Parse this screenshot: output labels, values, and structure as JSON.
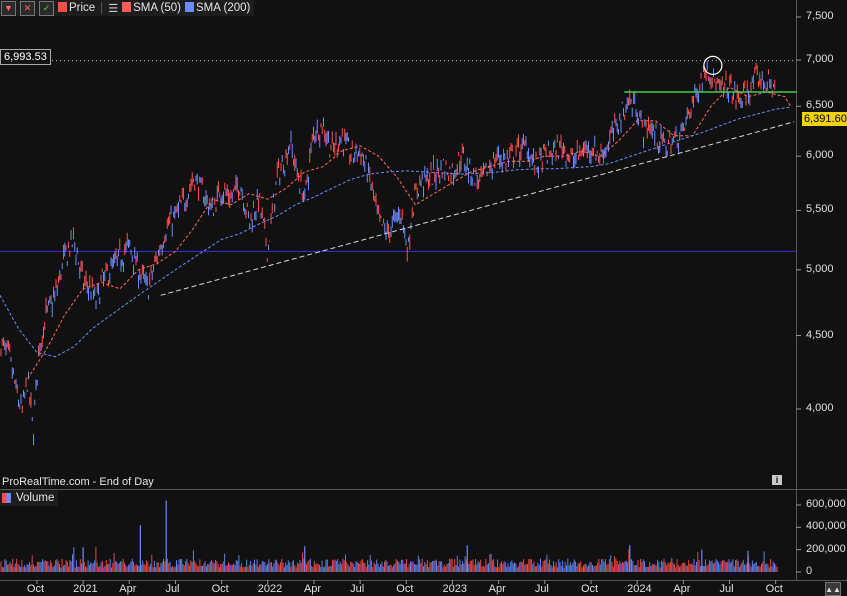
{
  "legend": {
    "price_label": "Price",
    "sma50_label": "SMA (50)",
    "sma200_label": "SMA (200)",
    "price_color": "#ff4d4d",
    "sma50_color": "#ff5a5a",
    "sma200_color": "#6a8cff"
  },
  "volume_legend": {
    "label": "Volume"
  },
  "source": "ProRealTime.com - End of Day",
  "reference_value": "6,993.53",
  "last_price": "6,391.60",
  "colors": {
    "background": "#111111",
    "up_bar": "#6a8cff",
    "down_bar": "#ff4d4d",
    "resistance": "#39d353",
    "support": "#3030c0",
    "trend": "#d8d8d8",
    "last_price_bg": "#f2d20f"
  },
  "chart_data": [
    {
      "type": "line",
      "title": "",
      "log_scale": true,
      "y_ticks": [
        "7,500",
        "7,000",
        "6,500",
        "6,000",
        "5,500",
        "5,000",
        "4,500",
        "4,000"
      ],
      "y_tick_values": [
        7500,
        7000,
        6500,
        6000,
        5500,
        5000,
        4500,
        4000
      ],
      "ylim": [
        3750,
        7800
      ],
      "x_ticks": [
        "Oct",
        "2021",
        "Apr",
        "Jul",
        "Oct",
        "2022",
        "Apr",
        "Jul",
        "Oct",
        "2023",
        "Apr",
        "Jul",
        "Oct",
        "2024",
        "Apr",
        "Jul",
        "Oct"
      ],
      "x_tick_times": [
        2020.75,
        2021.0,
        2021.25,
        2021.5,
        2021.75,
        2022.0,
        2022.25,
        2022.5,
        2022.75,
        2023.0,
        2023.25,
        2023.5,
        2023.75,
        2024.0,
        2024.25,
        2024.5,
        2024.75
      ],
      "xlim": [
        2020.55,
        2024.86
      ],
      "series": [
        {
          "name": "Price",
          "x": [
            2020.55,
            2020.6,
            2020.64,
            2020.67,
            2020.7,
            2020.73,
            2020.76,
            2020.8,
            2020.85,
            2020.9,
            2020.95,
            2021.0,
            2021.04,
            2021.07,
            2021.1,
            2021.15,
            2021.2,
            2021.25,
            2021.3,
            2021.35,
            2021.4,
            2021.45,
            2021.5,
            2021.55,
            2021.6,
            2021.65,
            2021.7,
            2021.75,
            2021.8,
            2021.85,
            2021.9,
            2021.95,
            2022.0,
            2022.05,
            2022.1,
            2022.12,
            2022.15,
            2022.2,
            2022.25,
            2022.3,
            2022.35,
            2022.4,
            2022.45,
            2022.5,
            2022.55,
            2022.6,
            2022.65,
            2022.72,
            2022.76,
            2022.78,
            2022.82,
            2022.88,
            2022.95,
            2023.0,
            2023.05,
            2023.1,
            2023.15,
            2023.2,
            2023.25,
            2023.3,
            2023.35,
            2023.4,
            2023.45,
            2023.5,
            2023.55,
            2023.6,
            2023.65,
            2023.7,
            2023.75,
            2023.8,
            2023.85,
            2023.9,
            2023.95,
            2024.0,
            2024.03,
            2024.07,
            2024.1,
            2024.15,
            2024.2,
            2024.25,
            2024.3,
            2024.35,
            2024.38,
            2024.41,
            2024.45,
            2024.5,
            2024.55,
            2024.6,
            2024.65,
            2024.7,
            2024.75,
            2024.8,
            2024.83
          ],
          "values": [
            4450,
            4350,
            4100,
            3980,
            4200,
            3850,
            4400,
            4650,
            4800,
            5100,
            5250,
            4900,
            4850,
            4750,
            4900,
            5000,
            5100,
            5200,
            5000,
            4850,
            5100,
            5350,
            5450,
            5600,
            5800,
            5650,
            5500,
            5700,
            5600,
            5750,
            5400,
            5600,
            5150,
            5800,
            6000,
            6150,
            5900,
            5600,
            6250,
            6300,
            6050,
            6200,
            6000,
            6050,
            5800,
            5400,
            5300,
            5500,
            5150,
            5500,
            5750,
            5800,
            5900,
            5850,
            6000,
            5850,
            5750,
            5900,
            6000,
            5950,
            6050,
            6100,
            5900,
            6000,
            6050,
            6100,
            5950,
            6050,
            6100,
            6000,
            6150,
            6350,
            6550,
            6500,
            6250,
            6300,
            6200,
            6100,
            6150,
            6250,
            6550,
            6800,
            6950,
            6800,
            6650,
            6700,
            6550,
            6650,
            6800,
            6750,
            6700,
            6550,
            6390
          ]
        },
        {
          "name": "SMA (50)",
          "x": [
            2020.7,
            2020.8,
            2020.9,
            2021.0,
            2021.1,
            2021.2,
            2021.3,
            2021.4,
            2021.5,
            2021.6,
            2021.7,
            2021.8,
            2021.9,
            2022.0,
            2022.1,
            2022.2,
            2022.3,
            2022.4,
            2022.5,
            2022.6,
            2022.7,
            2022.8,
            2022.9,
            2023.0,
            2023.1,
            2023.2,
            2023.3,
            2023.4,
            2023.5,
            2023.6,
            2023.7,
            2023.8,
            2023.9,
            2024.0,
            2024.1,
            2024.2,
            2024.3,
            2024.4,
            2024.5,
            2024.6,
            2024.7,
            2024.8,
            2024.83
          ],
          "values": [
            4200,
            4400,
            4650,
            4850,
            4900,
            4850,
            5000,
            5050,
            5150,
            5350,
            5600,
            5550,
            5650,
            5600,
            5700,
            5850,
            5900,
            6050,
            6100,
            6000,
            5800,
            5550,
            5650,
            5750,
            5850,
            5900,
            5950,
            5950,
            6000,
            6000,
            6050,
            6000,
            6150,
            6350,
            6350,
            6200,
            6200,
            6500,
            6700,
            6600,
            6650,
            6600,
            6500
          ]
        },
        {
          "name": "SMA (200)",
          "x": [
            2020.55,
            2020.65,
            2020.75,
            2020.85,
            2020.95,
            2021.05,
            2021.15,
            2021.25,
            2021.35,
            2021.45,
            2021.55,
            2021.65,
            2021.75,
            2021.85,
            2021.95,
            2022.05,
            2022.15,
            2022.25,
            2022.35,
            2022.45,
            2022.55,
            2022.65,
            2022.75,
            2022.85,
            2022.95,
            2023.05,
            2023.15,
            2023.25,
            2023.35,
            2023.45,
            2023.55,
            2023.65,
            2023.75,
            2023.85,
            2023.95,
            2024.05,
            2024.15,
            2024.25,
            2024.35,
            2024.45,
            2024.55,
            2024.65,
            2024.75,
            2024.83
          ],
          "values": [
            4800,
            4550,
            4380,
            4350,
            4420,
            4550,
            4650,
            4750,
            4850,
            4950,
            5050,
            5150,
            5250,
            5300,
            5380,
            5450,
            5550,
            5620,
            5700,
            5780,
            5830,
            5850,
            5860,
            5850,
            5840,
            5830,
            5840,
            5850,
            5870,
            5880,
            5880,
            5890,
            5900,
            5930,
            5990,
            6050,
            6110,
            6170,
            6230,
            6300,
            6370,
            6420,
            6470,
            6490
          ]
        }
      ]
    },
    {
      "type": "bar",
      "title": "Volume",
      "y_ticks": [
        "600,000",
        "400,000",
        "200,000",
        "0"
      ],
      "y_tick_values": [
        600000,
        400000,
        200000,
        0
      ],
      "ylim": [
        0,
        700000
      ],
      "spikes": [
        {
          "x": 2021.31,
          "value": 420000
        },
        {
          "x": 2021.45,
          "value": 640000
        },
        {
          "x": 2021.0,
          "value": 220000
        },
        {
          "x": 2022.2,
          "value": 230000
        },
        {
          "x": 2023.08,
          "value": 240000
        },
        {
          "x": 2023.96,
          "value": 240000
        },
        {
          "x": 2024.35,
          "value": 200000
        },
        {
          "x": 2024.6,
          "value": 190000
        }
      ],
      "typical_range": [
        40000,
        120000
      ]
    }
  ]
}
